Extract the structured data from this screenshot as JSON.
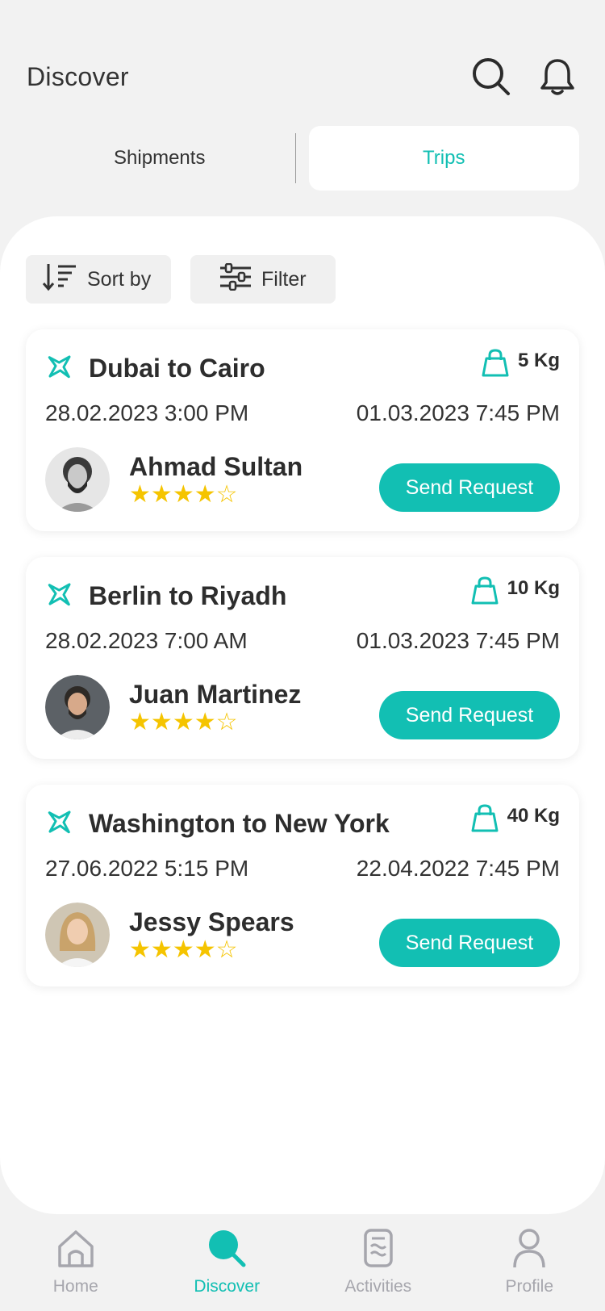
{
  "header": {
    "title": "Discover"
  },
  "tabs": [
    {
      "label": "Shipments",
      "active": false
    },
    {
      "label": "Trips",
      "active": true
    }
  ],
  "toolbar": {
    "sort_label": "Sort by",
    "filter_label": "Filter"
  },
  "trips": [
    {
      "route": "Dubai to Cairo",
      "weight": "5 Kg",
      "depart": "28.02.2023  3:00 PM",
      "arrive": "01.03.2023  7:45 PM",
      "name": "Ahmad Sultan",
      "rating": 4,
      "button": "Send Request"
    },
    {
      "route": "Berlin to Riyadh",
      "weight": "10 Kg",
      "depart": "28.02.2023  7:00 AM",
      "arrive": "01.03.2023  7:45 PM",
      "name": "Juan Martinez",
      "rating": 4,
      "button": "Send Request"
    },
    {
      "route": "Washington to New York",
      "weight": "40 Kg",
      "depart": "27.06.2022  5:15 PM",
      "arrive": "22.04.2022  7:45 PM",
      "name": "Jessy Spears",
      "rating": 4,
      "button": "Send Request"
    }
  ],
  "nav": [
    {
      "label": "Home",
      "icon": "home-icon",
      "active": false
    },
    {
      "label": "Discover",
      "icon": "search-icon",
      "active": true
    },
    {
      "label": "Activities",
      "icon": "document-icon",
      "active": false
    },
    {
      "label": "Profile",
      "icon": "user-icon",
      "active": false
    }
  ],
  "colors": {
    "accent": "#12bfb3",
    "star": "#f5c400",
    "background": "#f2f2f2"
  }
}
